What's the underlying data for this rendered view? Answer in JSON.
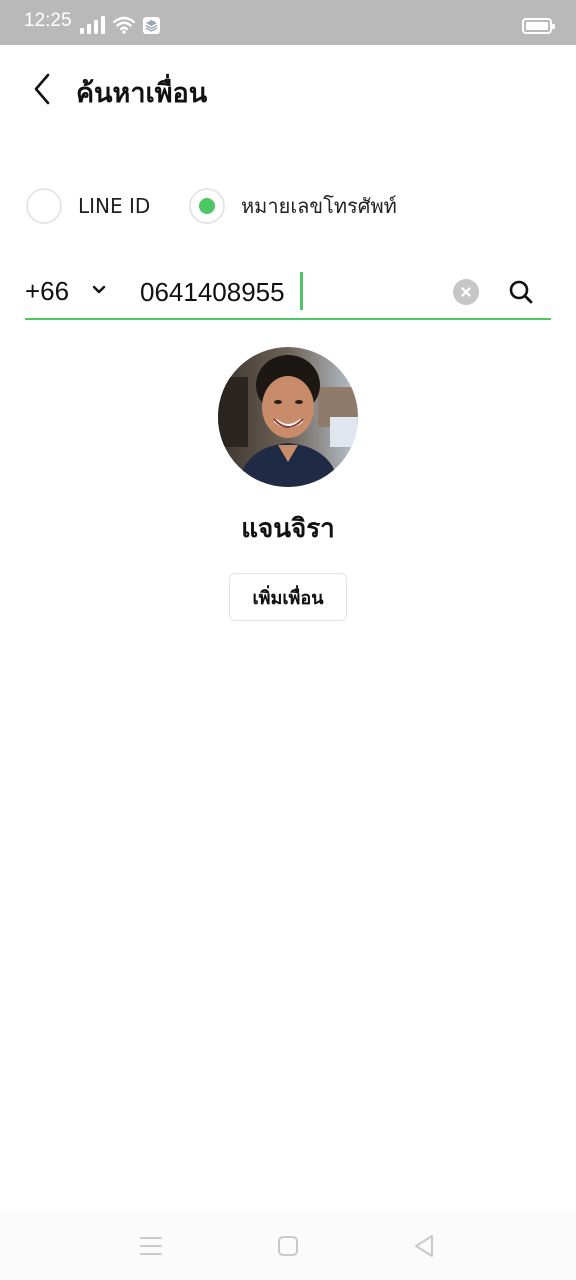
{
  "status_bar": {
    "time": "12:25",
    "icons": [
      "signal-icon",
      "wifi-icon",
      "layers-icon",
      "battery-icon"
    ]
  },
  "header": {
    "title": "ค้นหาเพื่อน",
    "back_icon": "chevron-left-icon"
  },
  "search_type": {
    "options": [
      {
        "label": "LINE ID",
        "selected": false
      },
      {
        "label": "หมายเลขโทรศัพท์",
        "selected": true
      }
    ]
  },
  "search": {
    "country_code": "+66",
    "phone_value": "0641408955",
    "accent_color": "#4cc764"
  },
  "result": {
    "name": "แจนจิรา",
    "add_button_label": "เพิ่มเพื่อน"
  },
  "nav_bar": {
    "icons": [
      "menu-icon",
      "home-square-icon",
      "back-triangle-icon"
    ]
  }
}
